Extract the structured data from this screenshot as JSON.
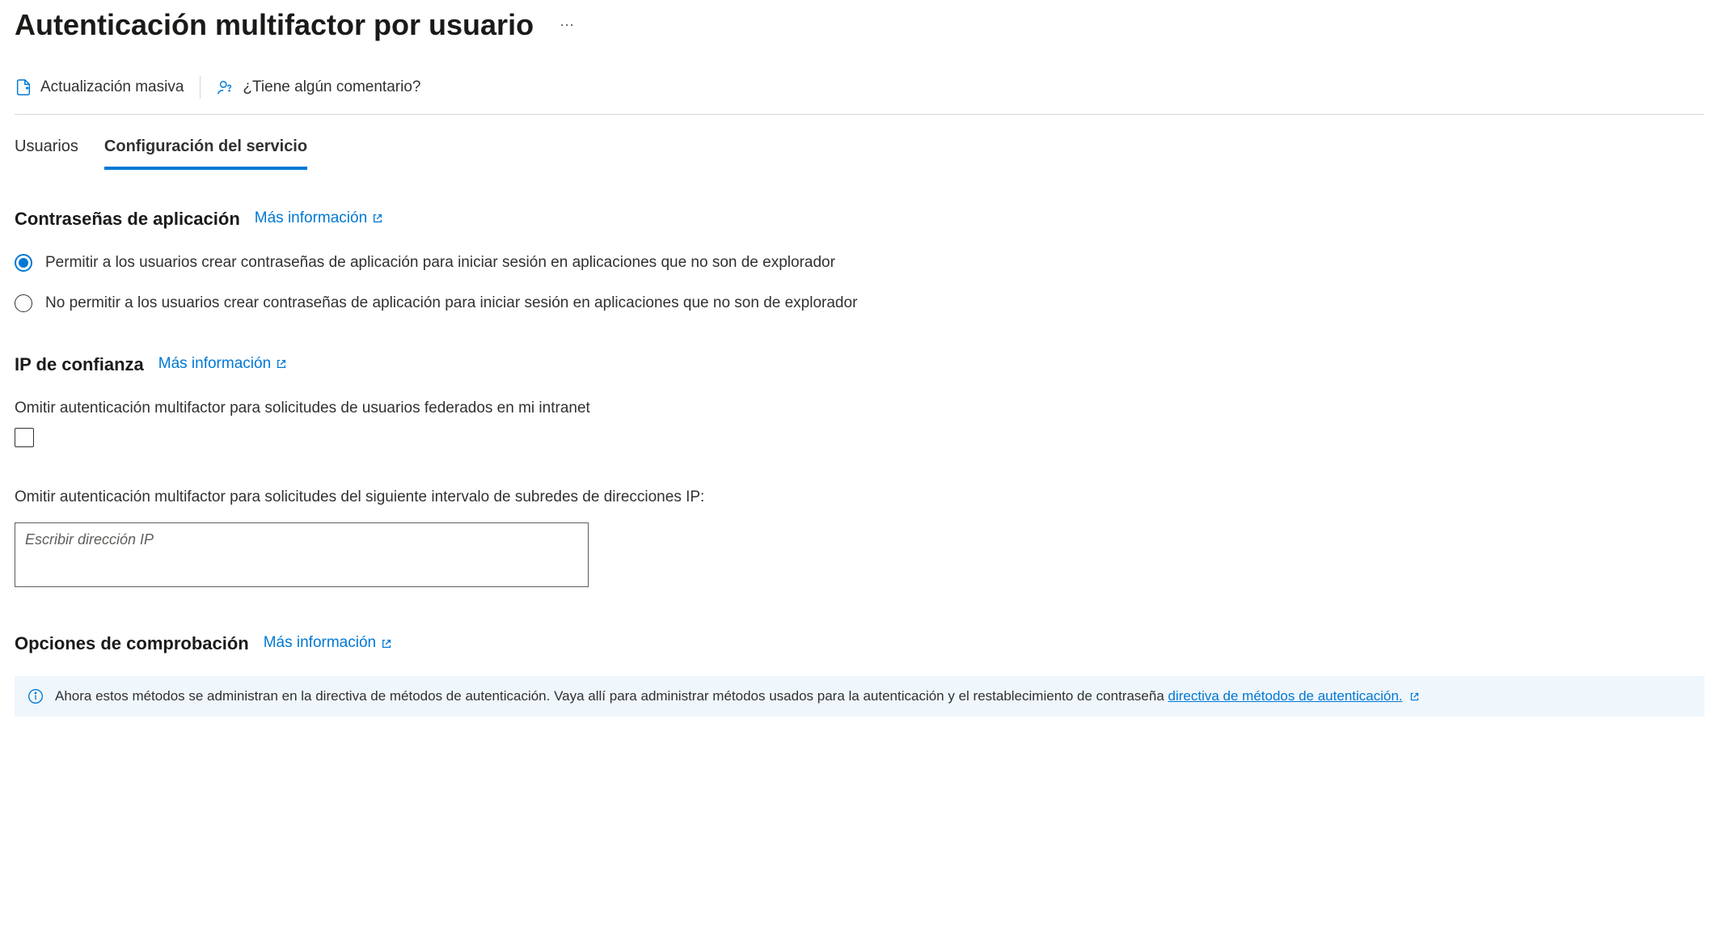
{
  "header": {
    "title": "Autenticación multifactor por usuario"
  },
  "commands": {
    "bulk_update": "Actualización masiva",
    "feedback": "¿Tiene algún comentario?"
  },
  "tabs": {
    "users": "Usuarios",
    "service_config": "Configuración del servicio"
  },
  "sections": {
    "app_passwords": {
      "title": "Contraseñas de aplicación",
      "learn_more": "Más información",
      "options": {
        "allow": "Permitir a los usuarios crear contraseñas de aplicación para iniciar sesión en aplicaciones que no son de explorador",
        "deny": "No permitir a los usuarios crear contraseñas de aplicación para iniciar sesión en aplicaciones que no son de explorador"
      },
      "selected": "allow"
    },
    "trusted_ips": {
      "title": "IP de confianza",
      "learn_more": "Más información",
      "skip_federated_label": "Omitir autenticación multifactor para solicitudes de usuarios federados en mi intranet",
      "skip_federated_checked": false,
      "ip_subnets_label": "Omitir autenticación multifactor para solicitudes del siguiente intervalo de subredes de direcciones IP:",
      "ip_placeholder": "Escribir dirección IP",
      "ip_value": ""
    },
    "verification_options": {
      "title": "Opciones de comprobación",
      "learn_more": "Más información",
      "info_banner_text": "Ahora estos métodos se administran en la directiva de métodos de autenticación. Vaya allí para administrar métodos usados para la autenticación y el restablecimiento de contraseña ",
      "info_banner_link": "directiva de métodos de autenticación."
    }
  }
}
